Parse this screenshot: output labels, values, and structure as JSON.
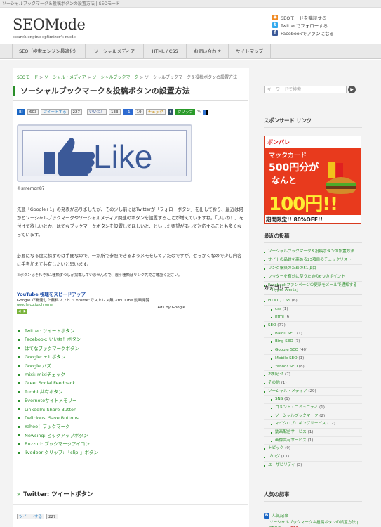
{
  "top_title": "ソーシャルブックマーク＆投稿ボタンの設置方法 | SEOモード",
  "logo": {
    "name": "SEOMode",
    "tagline": "search engine optimizer's mode"
  },
  "follow": [
    {
      "icon": "rss-icon",
      "label": "SEOモードを購読する",
      "color": "#f08a24"
    },
    {
      "icon": "twitter-icon",
      "label": "Twitterでフォローする",
      "color": "#33aaee"
    },
    {
      "icon": "facebook-icon",
      "label": "Facebookでファンになる",
      "color": "#3b5998"
    }
  ],
  "nav": [
    "SEO（検索エンジン最適化）",
    "ソーシャルメディア",
    "HTML / CSS",
    "お問い合わせ",
    "サイトマップ"
  ],
  "breadcrumb": {
    "items": [
      "SEOモード",
      "ソーシャル・メディア",
      "ソーシャルブックマーク"
    ],
    "current": "ソーシャルブックマーク＆投稿ボタンの設置方法"
  },
  "post_title": "ソーシャルブックマーク＆投稿ボタンの設置方法",
  "share_bar": {
    "hatena_count": "603",
    "tweet_label": "ツイートする",
    "tweet_count": "227",
    "fb_like": "いいね！",
    "fb_count": "133",
    "gplus": "+1",
    "gplus_count": "19",
    "mixi": "チェック",
    "tumblr": "t",
    "clip": "クリップ"
  },
  "like_image_text": "Like",
  "credit": "©smemon87",
  "para1": "先週「Google+1」の発表がありましたが、その少し前にはTwitterが「フォローボタン」を出しており、最近は何かとソーシャルブックマークやソーシャルメディア関連のボタンを設置することが増えていますね。「いいね！」を付けて欲しいとか、はてなブックマークボタンを設置してほしいと、といった要望があって対応することも多くなっています。",
  "para2": "必要になる度に探すのは手間なので、一か所で参照できるようメモをしていたのですが、せっかくなので少し内容に手を加えて共有したいと思います。",
  "note": "※ボタンはそれぞれ1種類ずつしか掲載していませんので、違う種類はリンク先でご確認ください。",
  "ad": {
    "title": "YouTube 視聴をスピードアップ",
    "desc": "Google が開発した無料ソフト \"Chrome\"でストレス無いYouTube 動画閲覧",
    "url": "google.co.jp/chrome",
    "ads_by": "Ads by Google"
  },
  "links": [
    "Twitter: ツイートボタン",
    "Facebook: いいね！ボタン",
    "はてなブックマークボタン",
    "Google: +1 ボタン",
    "Google バズ",
    "mixi: mixiチェック",
    "Gree: Social Feedback",
    "Tumblr共有ボタン",
    "Evernoteサイトメモリー",
    "LinkedIn: Share Button",
    "Delicious: Save Buttons",
    "Yahoo！ブックマーク",
    "Newsing: ピックアップボタン",
    "Buzzurl: ブックマークアイコン",
    "livedoor クリップ: 「clip!」ボタン"
  ],
  "section_heading": "Twitter: ツイートボタン",
  "share2": {
    "tweet_label": "ツイートする",
    "tweet_count": "227"
  },
  "sidebar": {
    "search_placeholder": "キーワードで検索",
    "sponsored": "スポンサード リンク",
    "banner": {
      "brand": "ポンパレ",
      "line1": "マックカード",
      "line2": "500円分が",
      "line3": "なんと",
      "line4": "100円!!",
      "bottom": "期間限定!! 80%OFF!!"
    },
    "recent_title": "最近の投稿",
    "recent": [
      "ソーシャルブックマーク＆投稿ボタンの設置方法",
      "サイトの品質を高める23項目のチェックリスト",
      "リンク構築のための51項目",
      "フッターを有効に使うための6つのポイント",
      "Facebookファンページの更新をメールで通知する「Hyper Alerts」"
    ],
    "category_title": "カテゴリー",
    "categories": [
      {
        "label": "HTML / CSS",
        "count": "(6)",
        "level": 0
      },
      {
        "label": "css",
        "count": "(1)",
        "level": 1
      },
      {
        "label": "html",
        "count": "(6)",
        "level": 1
      },
      {
        "label": "SEO",
        "count": "(77)",
        "level": 0
      },
      {
        "label": "Baidu SEO",
        "count": "(1)",
        "level": 1
      },
      {
        "label": "Bing SEO",
        "count": "(7)",
        "level": 1
      },
      {
        "label": "Google SEO",
        "count": "(40)",
        "level": 1
      },
      {
        "label": "Mobile SEO",
        "count": "(1)",
        "level": 1
      },
      {
        "label": "Yahoo! SEO",
        "count": "(8)",
        "level": 1
      },
      {
        "label": "お知らせ",
        "count": "(7)",
        "level": 0
      },
      {
        "label": "その他",
        "count": "(1)",
        "level": 0
      },
      {
        "label": "ソーシャル・メディア",
        "count": "(29)",
        "level": 0
      },
      {
        "label": "SNS",
        "count": "(1)",
        "level": 1
      },
      {
        "label": "コメント・コミュニティ",
        "count": "(1)",
        "level": 1
      },
      {
        "label": "ソーシャルブックマーク",
        "count": "(2)",
        "level": 1
      },
      {
        "label": "マイクロブロギングサービス",
        "count": "(12)",
        "level": 1
      },
      {
        "label": "動画配信サービス",
        "count": "(1)",
        "level": 1
      },
      {
        "label": "画像共有サービス",
        "count": "(1)",
        "level": 1
      },
      {
        "label": "トピック",
        "count": "(9)",
        "level": 0
      },
      {
        "label": "ブログ",
        "count": "(11)",
        "level": 0
      },
      {
        "label": "ユーザビリティ",
        "count": "(3)",
        "level": 0
      }
    ],
    "popular_title": "人気の記事",
    "popular_feed": "人気記事",
    "popular_item": "ソーシャルブックマーク＆投稿ボタンの設置方法 | SEOモー...",
    "popular_users": "603users"
  }
}
